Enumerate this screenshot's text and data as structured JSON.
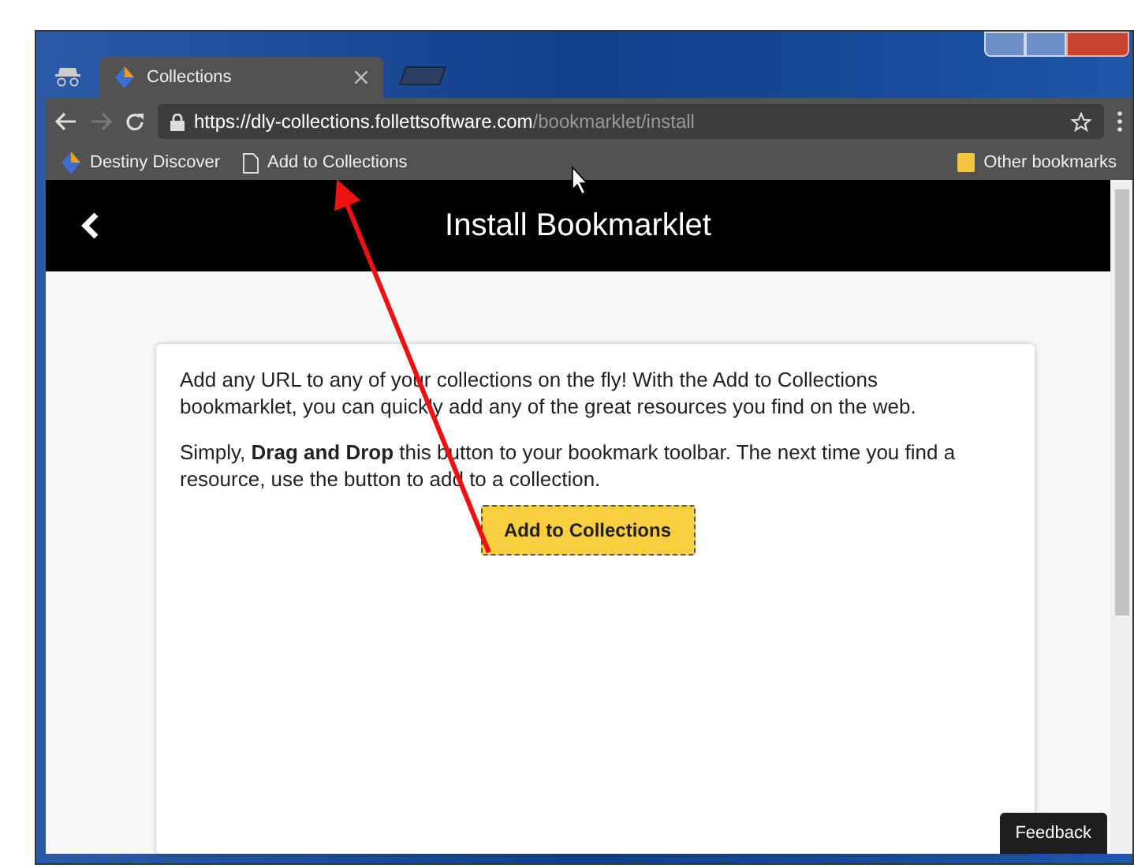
{
  "browser": {
    "tab": {
      "title": "Collections",
      "selected": true
    },
    "address": {
      "host": "https://dly-collections.follettsoftware.com",
      "path": "/bookmarklet/install"
    },
    "bookmarks": [
      {
        "kind": "site",
        "label": "Destiny Discover"
      },
      {
        "kind": "page",
        "label": "Add to Collections"
      }
    ],
    "other_bookmarks": "Other bookmarks"
  },
  "page": {
    "title": "Install Bookmarklet",
    "paragraphs": [
      "Add any URL to any of your collections on the fly! With the Add to Collections bookmarklet, you can quickly add any of the great resources you find on the web.",
      "Simply, **Drag and Drop** this button to your bookmark toolbar. The next time you find a resource, use the button to add to a collection."
    ],
    "button": "Add to Collections",
    "feedback": "Feedback"
  }
}
